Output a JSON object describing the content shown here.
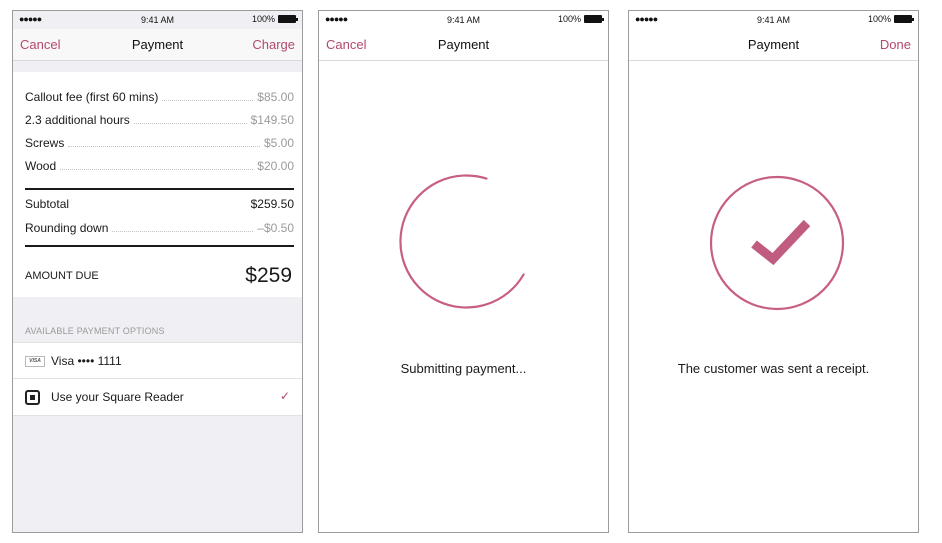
{
  "colors": {
    "accent": "#b4486e",
    "ring": "#c75f84",
    "check": "#c05c80"
  },
  "screens": [
    {
      "statusbar": {
        "signal": "●●●●●",
        "time": "9:41 AM",
        "battery": "100%"
      },
      "nav": {
        "left": "Cancel",
        "title": "Payment",
        "right": "Charge"
      },
      "line_items": [
        {
          "label": "Callout fee (first 60 mins)",
          "amount": "$85.00"
        },
        {
          "label": "2.3 additional hours",
          "amount": "$149.50"
        },
        {
          "label": "Screws",
          "amount": "$5.00"
        },
        {
          "label": "Wood",
          "amount": "$20.00"
        }
      ],
      "subtotal": {
        "label": "Subtotal",
        "amount": "$259.50"
      },
      "rounding": {
        "label": "Rounding down",
        "amount": "–$0.50"
      },
      "amount_due": {
        "label": "AMOUNT DUE",
        "amount": "$259"
      },
      "options_header": "AVAILABLE PAYMENT OPTIONS",
      "options": [
        {
          "icon": "visa-card-icon",
          "icon_text": "VISA",
          "label": "Visa •••• 1111",
          "selected": false
        },
        {
          "icon": "square-reader-icon",
          "label": "Use your Square Reader",
          "selected": true,
          "check": "✓"
        }
      ]
    },
    {
      "statusbar": {
        "signal": "●●●●●",
        "time": "9:41 AM",
        "battery": "100%"
      },
      "nav": {
        "left": "Cancel",
        "title": "Payment"
      },
      "indicator": "loading-ring-icon",
      "status": "Submitting payment..."
    },
    {
      "statusbar": {
        "signal": "●●●●●",
        "time": "9:41 AM",
        "battery": "100%"
      },
      "nav": {
        "title": "Payment",
        "right": "Done"
      },
      "indicator": "checkmark-circle-icon",
      "status": "The customer was sent a receipt."
    }
  ]
}
